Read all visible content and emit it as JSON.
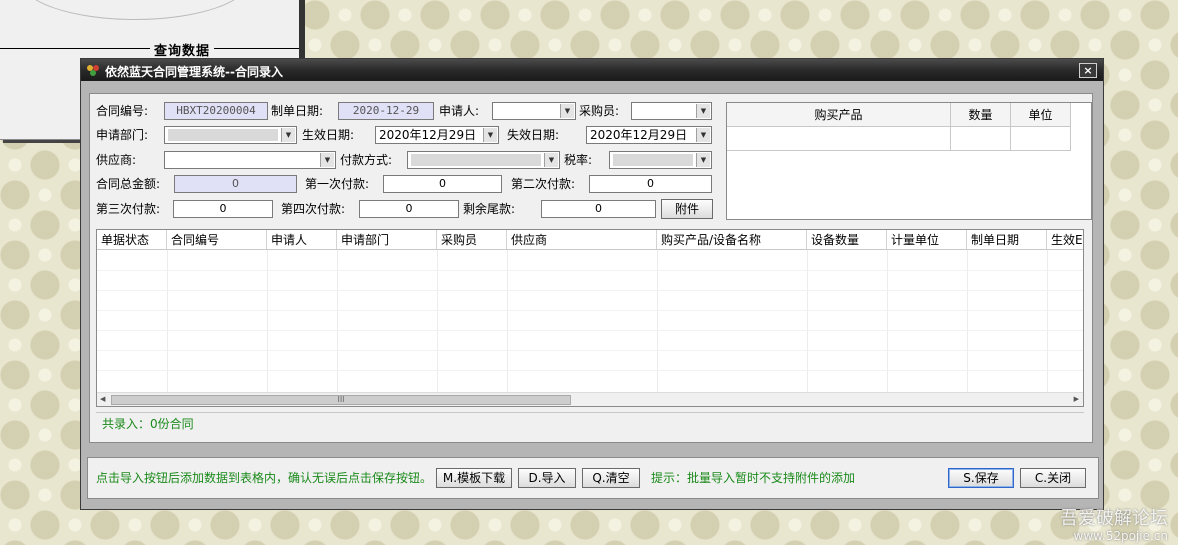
{
  "background_window": {
    "title": "查询数据"
  },
  "window": {
    "title": "依然蓝天合同管理系统--合同录入",
    "close_glyph": "×"
  },
  "form": {
    "contract_no_label": "合同编号:",
    "contract_no_value": "HBXT20200004",
    "create_date_label": "制单日期:",
    "create_date_value": "2020-12-29",
    "applicant_label": "申请人:",
    "applicant_value": "",
    "purchaser_label": "采购员:",
    "purchaser_value": "",
    "dept_label": "申请部门:",
    "effective_date_label": "生效日期:",
    "effective_date_value": "2020年12月29日",
    "expiry_date_label": "失效日期:",
    "expiry_date_value": "2020年12月29日",
    "supplier_label": "供应商:",
    "supplier_value": "",
    "payment_method_label": "付款方式:",
    "tax_rate_label": "税率:",
    "total_amount_label": "合同总金额:",
    "total_amount_value": "0",
    "pay1_label": "第一次付款:",
    "pay1_value": "0",
    "pay2_label": "第二次付款:",
    "pay2_value": "0",
    "pay3_label": "第三次付款:",
    "pay3_value": "0",
    "pay4_label": "第四次付款:",
    "pay4_value": "0",
    "balance_label": "剩余尾款:",
    "balance_value": "0",
    "attachment_button": "附件"
  },
  "product_table": {
    "headers": [
      "购买产品",
      "数量",
      "单位"
    ]
  },
  "grid": {
    "headers": [
      "单据状态",
      "合同编号",
      "申请人",
      "申请部门",
      "采购员",
      "供应商",
      "购买产品/设备名称",
      "设备数量",
      "计量单位",
      "制单日期",
      "生效E"
    ],
    "scroll_thumb": "III"
  },
  "status": {
    "text": "共录入：0份合同"
  },
  "bottom": {
    "hint": "点击导入按钮后添加数据到表格内，确认无误后点击保存按钮。",
    "template_button": "M.模板下载",
    "import_button": "D.导入",
    "clear_button": "Q.清空",
    "tip": "提示：批量导入暂时不支持附件的添加",
    "save_button": "S.保存",
    "close_button": "C.关闭"
  },
  "watermark": {
    "title": "吾爱破解论坛",
    "url": "www.52pojie.cn"
  },
  "colors": {
    "titlebar": "#2a2a2a",
    "readonly_field": "#e0e0f6",
    "status_green": "#1a8a1a",
    "focus_border": "#2f66c9"
  }
}
